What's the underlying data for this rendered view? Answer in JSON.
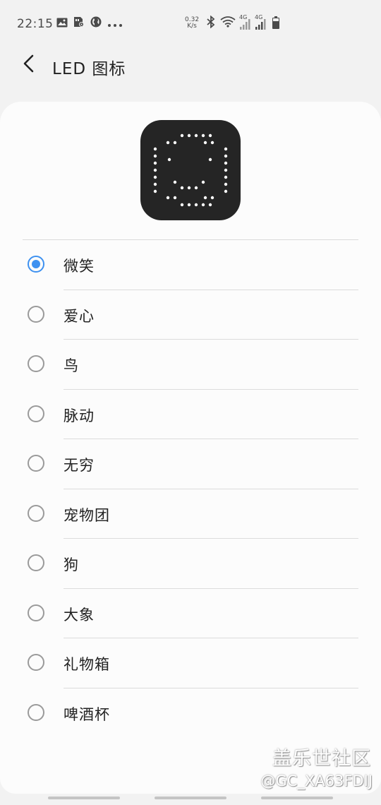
{
  "status_bar": {
    "time": "22:15",
    "net_speed_value": "0.32",
    "net_speed_unit": "K/s",
    "sim1_label": "4G",
    "sim2_label": "4G",
    "battery_level": 0.7,
    "left_icons": [
      "image-icon",
      "sim-settings-icon",
      "globe-icon",
      "more-dots-icon"
    ],
    "right_icons": [
      "bluetooth-icon",
      "wifi-icon",
      "signal-icon",
      "signal-icon",
      "battery-icon"
    ]
  },
  "header": {
    "back_icon": "back-arrow-icon",
    "title": "LED 图标"
  },
  "preview": {
    "icon": "led-smile-dot-matrix",
    "background_color": "#252525",
    "dot_color": "#ffffff"
  },
  "options": [
    {
      "label": "微笑",
      "selected": true
    },
    {
      "label": "爱心",
      "selected": false
    },
    {
      "label": "鸟",
      "selected": false
    },
    {
      "label": "脉动",
      "selected": false
    },
    {
      "label": "无穷",
      "selected": false
    },
    {
      "label": "宠物团",
      "selected": false
    },
    {
      "label": "狗",
      "selected": false
    },
    {
      "label": "大象",
      "selected": false
    },
    {
      "label": "礼物箱",
      "selected": false
    },
    {
      "label": "啤酒杯",
      "selected": false
    }
  ],
  "accent_color": "#3e91f0",
  "watermark": {
    "site": "盖乐世社区",
    "user": "@GC_XA63FDIJ"
  }
}
